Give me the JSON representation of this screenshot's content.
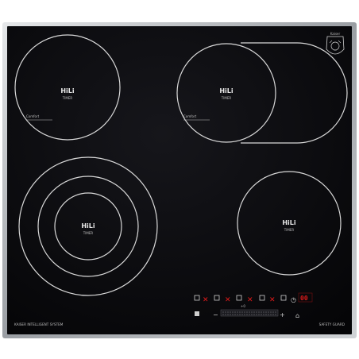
{
  "colors": {
    "frame": "#bfc3c7",
    "glass": "#08080b",
    "ring": "#d9d9d9",
    "led_red": "#e01a1a"
  },
  "zones": [
    {
      "brand": "HiLi",
      "sub": "TIMER",
      "extra": "Comfort"
    },
    {
      "brand": "HiLi",
      "sub": "TIMER",
      "extra": "Comfort"
    },
    {
      "brand": "HiLi",
      "sub": "TIMER"
    },
    {
      "brand": "HiLi",
      "sub": "TIMER"
    }
  ],
  "footer": {
    "left": "KAISER INTELLIGENT SYSTEM",
    "right": "SAFETY GUARD"
  },
  "logo": {
    "text": "Kaiser"
  },
  "control_panel": {
    "display": "00",
    "bar_label": "+0"
  }
}
